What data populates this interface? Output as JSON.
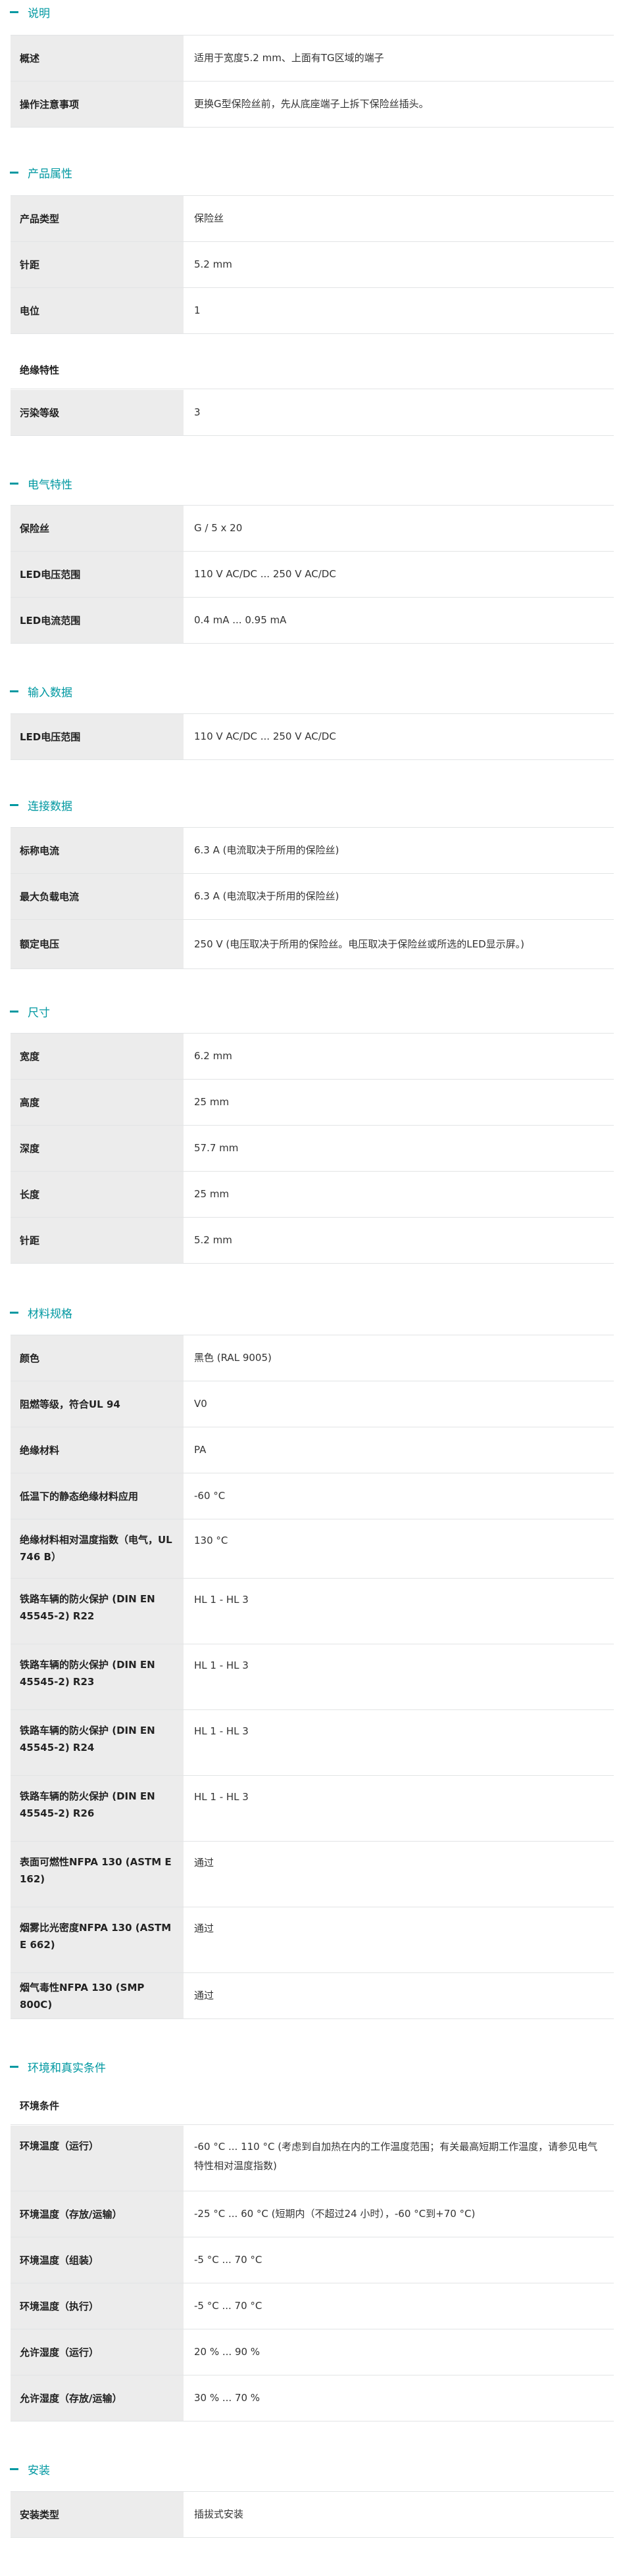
{
  "sections": [
    {
      "title": "说明",
      "rows": [
        {
          "label": "概述",
          "value": "适用于宽度5.2 mm、上面有TG区域的端子"
        },
        {
          "label": "操作注意事项",
          "value": "更换G型保险丝前，先从底座端子上拆下保险丝插头。"
        }
      ]
    },
    {
      "title": "产品属性",
      "rows": [
        {
          "label": "产品类型",
          "value": "保险丝"
        },
        {
          "label": "针距",
          "value": "5.2 mm"
        },
        {
          "label": "电位",
          "value": "1"
        }
      ],
      "subheader": "绝缘特性",
      "rows2": [
        {
          "label": "污染等级",
          "value": "3"
        }
      ]
    },
    {
      "title": "电气特性",
      "rows": [
        {
          "label": "保险丝",
          "value": "G / 5 x 20"
        },
        {
          "label": "LED电压范围",
          "value": "110 V AC/DC ... 250 V AC/DC"
        },
        {
          "label": "LED电流范围",
          "value": "0.4 mA ... 0.95 mA"
        }
      ]
    },
    {
      "title": "输入数据",
      "rows": [
        {
          "label": "LED电压范围",
          "value": "110 V AC/DC ... 250 V AC/DC"
        }
      ]
    },
    {
      "title": "连接数据",
      "rows": [
        {
          "label": "标称电流",
          "value": "6.3 A (电流取决于所用的保险丝)"
        },
        {
          "label": "最大负载电流",
          "value": "6.3 A (电流取决于所用的保险丝)"
        },
        {
          "label": "额定电压",
          "value": "250 V (电压取决于所用的保险丝。电压取决于保险丝或所选的LED显示屏。)"
        }
      ]
    },
    {
      "title": "尺寸",
      "rows": [
        {
          "label": "宽度",
          "value": "6.2 mm"
        },
        {
          "label": "高度",
          "value": "25 mm"
        },
        {
          "label": "深度",
          "value": "57.7 mm"
        },
        {
          "label": "长度",
          "value": "25 mm"
        },
        {
          "label": "针距",
          "value": "5.2 mm"
        }
      ]
    },
    {
      "title": "材料规格",
      "rows": [
        {
          "label": "颜色",
          "value": "黑色 (RAL 9005)"
        },
        {
          "label": "阻燃等级，符合UL 94",
          "value": "V0"
        },
        {
          "label": "绝缘材料",
          "value": "PA"
        },
        {
          "label": "低温下的静态绝缘材料应用",
          "value": "-60 °C"
        },
        {
          "label": "绝缘材料相对温度指数（电气，UL 746 B）",
          "value": "130 °C"
        },
        {
          "label": "铁路车辆的防火保护 (DIN EN 45545-2) R22",
          "value": "HL 1 - HL 3"
        },
        {
          "label": "铁路车辆的防火保护 (DIN EN 45545-2) R23",
          "value": "HL 1 - HL 3"
        },
        {
          "label": "铁路车辆的防火保护 (DIN EN 45545-2) R24",
          "value": "HL 1 - HL 3"
        },
        {
          "label": "铁路车辆的防火保护 (DIN EN 45545-2) R26",
          "value": "HL 1 - HL 3"
        },
        {
          "label": "表面可燃性NFPA 130 (ASTM E 162)",
          "value": "通过"
        },
        {
          "label": "烟雾比光密度NFPA 130 (ASTM E 662)",
          "value": "通过"
        },
        {
          "label": "烟气毒性NFPA 130 (SMP 800C)",
          "value": "通过"
        }
      ]
    },
    {
      "title": "环境和真实条件",
      "subheader": "环境条件",
      "rows": [
        {
          "label": "环境温度（运行）",
          "value": "-60 °C ... 110 °C (考虑到自加热在内的工作温度范围；有关最高短期工作温度，请参见电气特性相对温度指数)"
        },
        {
          "label": "环境温度（存放/运输）",
          "value": "-25 °C ... 60 °C (短期内（不超过24 小时），-60 °C到+70 °C)"
        },
        {
          "label": "环境温度（组装）",
          "value": "-5 °C ... 70 °C"
        },
        {
          "label": "环境温度（执行）",
          "value": "-5 °C ... 70 °C"
        },
        {
          "label": "允许湿度（运行）",
          "value": "20 % ... 90 %"
        },
        {
          "label": "允许湿度（存放/运输）",
          "value": "30 % ... 70 %"
        }
      ]
    },
    {
      "title": "安装",
      "rows": [
        {
          "label": "安装类型",
          "value": "插拔式安装"
        }
      ]
    }
  ]
}
